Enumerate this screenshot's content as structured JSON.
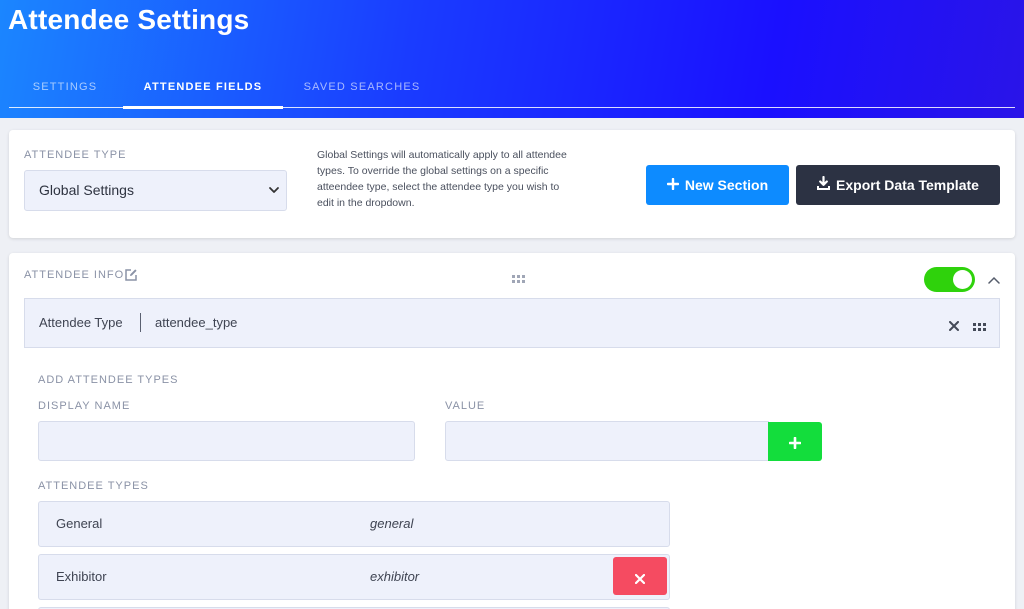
{
  "page": {
    "title": "Attendee Settings"
  },
  "tabs": [
    {
      "label": "SETTINGS",
      "active": false
    },
    {
      "label": "ATTENDEE FIELDS",
      "active": true
    },
    {
      "label": "SAVED SEARCHES",
      "active": false
    }
  ],
  "type_card": {
    "label": "ATTENDEE TYPE",
    "selected": "Global Settings",
    "description": "Global Settings will automatically apply to all attendee types. To override the global settings on a specific atteendee type, select the attendee type you wish to edit in the dropdown.",
    "new_section_label": "New Section",
    "export_label": "Export Data Template"
  },
  "section": {
    "title": "ATTENDEE INFO",
    "enabled": true,
    "field_label": "Attendee Type",
    "field_key": "attendee_type",
    "add_title": "ADD ATTENDEE TYPES",
    "display_name_label": "DISPLAY NAME",
    "value_label": "VALUE",
    "display_name_value": "",
    "value_value": "",
    "list_title": "ATTENDEE TYPES",
    "types": [
      {
        "name": "General",
        "value": "general",
        "deletable": false
      },
      {
        "name": "Exhibitor",
        "value": "exhibitor",
        "deletable": true
      }
    ]
  },
  "colors": {
    "header_gradient_start": "#1b86ff",
    "header_gradient_end": "#1a10ff",
    "primary_button": "#0d8bff",
    "dark_button": "#2c3243",
    "toggle_on": "#2fd20c",
    "add_button": "#13dd3c",
    "delete_button": "#f54b61"
  },
  "icons": {
    "new_section": "plus-icon",
    "export": "download-icon",
    "section_edit": "edit-icon",
    "drag": "drag-handle-icon",
    "collapse": "chevron-up-icon",
    "remove_field": "close-icon",
    "add_type": "plus-icon",
    "delete_type": "close-icon",
    "dropdown": "chevron-down-icon"
  }
}
